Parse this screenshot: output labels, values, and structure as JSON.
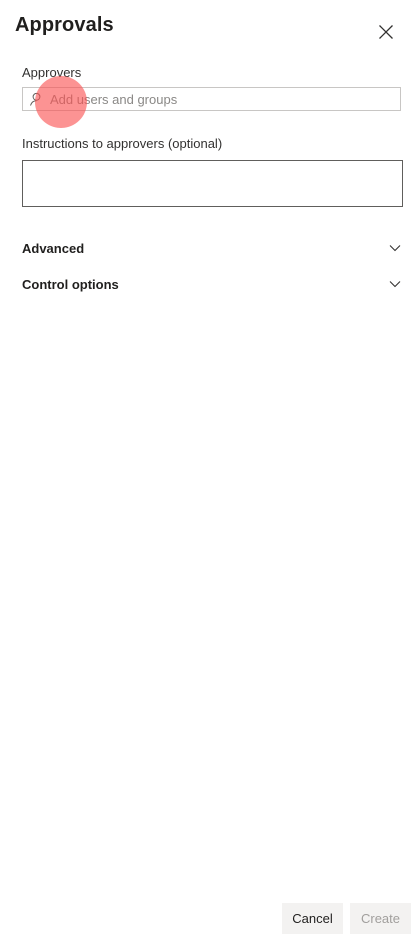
{
  "header": {
    "title": "Approvals",
    "close_icon": "close-icon"
  },
  "approvers": {
    "label": "Approvers",
    "placeholder": "Add users and groups",
    "value": "",
    "icon": "person-icon"
  },
  "instructions": {
    "label": "Instructions to approvers (optional)",
    "value": ""
  },
  "sections": [
    {
      "label": "Advanced",
      "icon": "chevron-down-icon",
      "expanded": false
    },
    {
      "label": "Control options",
      "icon": "chevron-down-icon",
      "expanded": false
    }
  ],
  "footer": {
    "cancel_label": "Cancel",
    "create_label": "Create",
    "create_enabled": false
  },
  "colors": {
    "cursor_highlight": "#fa5050",
    "border": "#c8c6c4",
    "disabled_text": "#a19f9d",
    "button_bg": "#f3f2f1"
  }
}
